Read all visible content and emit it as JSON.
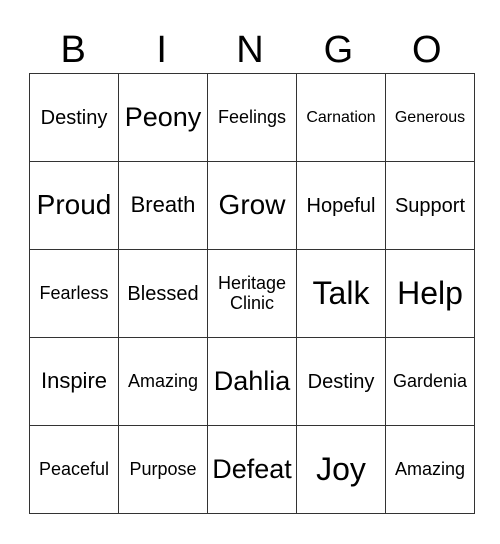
{
  "header": [
    "B",
    "I",
    "N",
    "G",
    "O"
  ],
  "rows": [
    [
      "Destiny",
      "Peony",
      "Feelings",
      "Carnation",
      "Generous"
    ],
    [
      "Proud",
      "Breath",
      "Grow",
      "Hopeful",
      "Support"
    ],
    [
      "Fearless",
      "Blessed",
      "Heritage Clinic",
      "Talk",
      "Help"
    ],
    [
      "Inspire",
      "Amazing",
      "Dahlia",
      "Destiny",
      "Gardenia"
    ],
    [
      "Peaceful",
      "Purpose",
      "Defeat",
      "Joy",
      "Amazing"
    ]
  ]
}
